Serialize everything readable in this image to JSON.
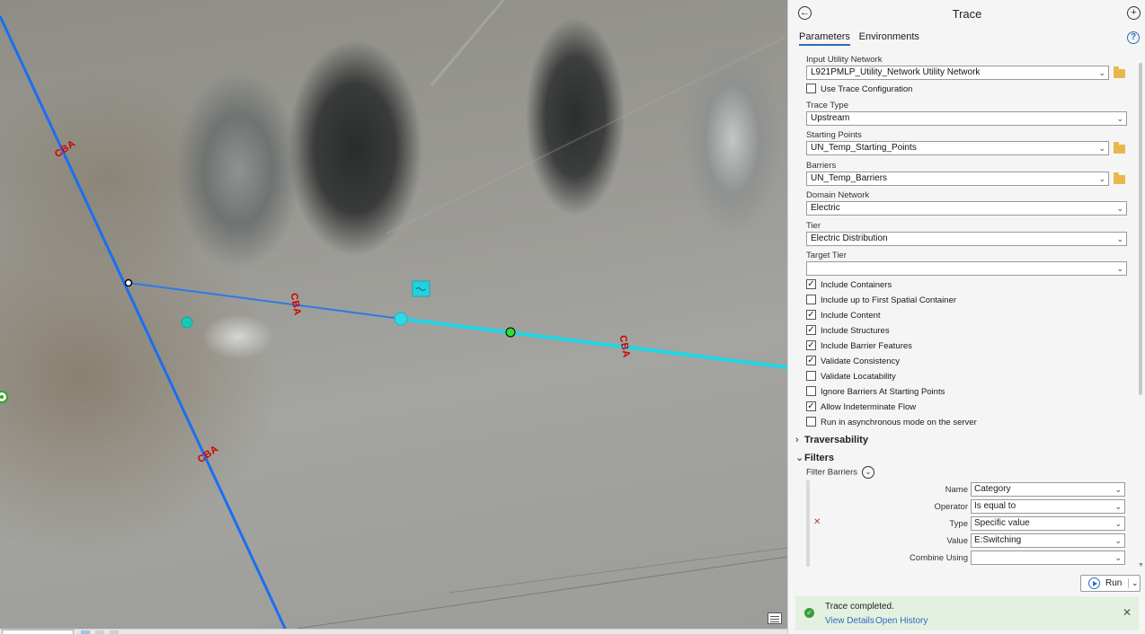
{
  "map": {
    "line_labels": [
      "CBA",
      "CBA",
      "CBA",
      "CBA"
    ]
  },
  "pane": {
    "title": "Trace",
    "tabs": [
      "Parameters",
      "Environments"
    ],
    "fields": {
      "input_network_label": "Input Utility Network",
      "input_network_value": "L921PMLP_Utility_Network Utility Network",
      "use_trace_config": "Use Trace Configuration",
      "trace_type_label": "Trace Type",
      "trace_type_value": "Upstream",
      "starting_points_label": "Starting Points",
      "starting_points_value": "UN_Temp_Starting_Points",
      "barriers_label": "Barriers",
      "barriers_value": "UN_Temp_Barriers",
      "domain_label": "Domain Network",
      "domain_value": "Electric",
      "tier_label": "Tier",
      "tier_value": "Electric Distribution",
      "target_tier_label": "Target Tier",
      "target_tier_value": ""
    },
    "options": [
      {
        "label": "Include Containers",
        "checked": true
      },
      {
        "label": "Include up to First Spatial Container",
        "checked": false
      },
      {
        "label": "Include Content",
        "checked": true
      },
      {
        "label": "Include Structures",
        "checked": true
      },
      {
        "label": "Include Barrier Features",
        "checked": true
      },
      {
        "label": "Validate Consistency",
        "checked": true
      },
      {
        "label": "Validate Locatability",
        "checked": false
      },
      {
        "label": "Ignore Barriers At Starting Points",
        "checked": false
      },
      {
        "label": "Allow Indeterminate Flow",
        "checked": true
      },
      {
        "label": "Run in asynchronous mode on the server",
        "checked": false
      }
    ],
    "sections": {
      "traversability": "Traversability",
      "filters": "Filters"
    },
    "filter_barriers": {
      "label": "Filter Barriers",
      "name_label": "Name",
      "name_value": "Category",
      "operator_label": "Operator",
      "operator_value": "Is equal to",
      "type_label": "Type",
      "type_value": "Specific value",
      "value_label": "Value",
      "value_value": "E:Switching",
      "combine_label": "Combine Using",
      "combine_value": ""
    },
    "run_label": "Run",
    "status": {
      "message": "Trace completed.",
      "view_details": "View Details",
      "open_history": "Open History"
    }
  }
}
